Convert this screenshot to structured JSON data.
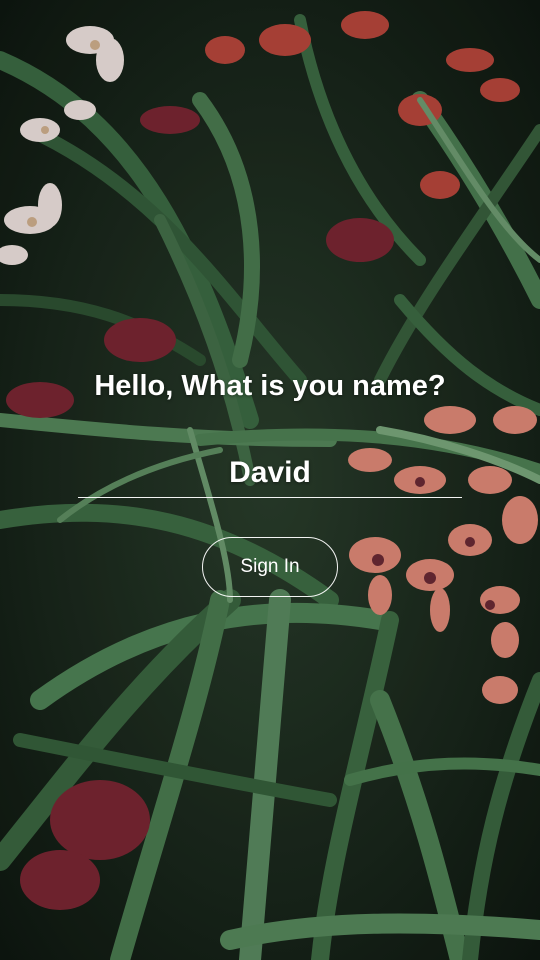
{
  "prompt": {
    "text": "Hello, What is you name?"
  },
  "name_field": {
    "value": "David",
    "placeholder": ""
  },
  "signin": {
    "label": "Sign In"
  },
  "theme": {
    "text_color": "#ffffff",
    "leaf_color": "#3f6a45",
    "flower_color": "#e07a6a"
  },
  "background": {
    "description_icon": "orchid-plants-photo"
  }
}
